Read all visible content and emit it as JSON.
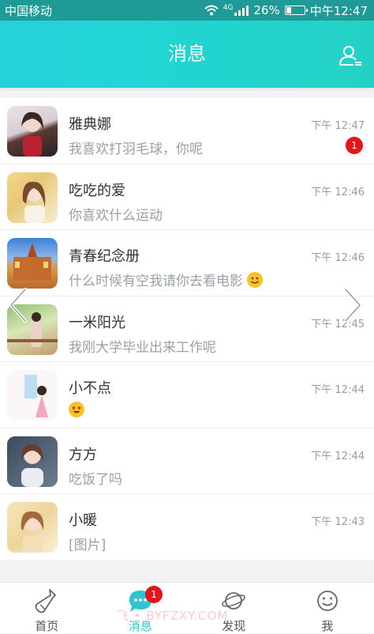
{
  "status_bar": {
    "carrier": "中国移动",
    "network": "4G",
    "battery": "26%",
    "time": "中午12:47"
  },
  "header": {
    "title": "消息",
    "contacts_icon": "contacts-icon"
  },
  "conversations": [
    {
      "name": "雅典娜",
      "preview": "我喜欢打羽毛球，你呢",
      "time": "下午 12:47",
      "unread": "1"
    },
    {
      "name": "吃吃的爱",
      "preview": "你喜欢什么运动",
      "time": "下午 12:46"
    },
    {
      "name": "青春纪念册",
      "preview": "什么时候有空我请你去看电影",
      "time": "下午 12:46",
      "emoji": "smile"
    },
    {
      "name": "一米阳光",
      "preview": "我刚大学毕业出来工作呢",
      "time": "下午 12:45"
    },
    {
      "name": "小不点",
      "preview": "",
      "time": "下午 12:44",
      "emoji": "heart-eyes"
    },
    {
      "name": "方方",
      "preview": "吃饭了吗",
      "time": "下午 12:44"
    },
    {
      "name": "小暖",
      "preview": "[图片]",
      "time": "下午 12:43"
    }
  ],
  "tabs": [
    {
      "label": "首页",
      "icon": "bottle-icon"
    },
    {
      "label": "消息",
      "icon": "chat-bubble-icon",
      "badge": "1",
      "active": true
    },
    {
      "label": "发现",
      "icon": "planet-icon"
    },
    {
      "label": "我",
      "icon": "smiley-icon"
    }
  ],
  "watermark": "飞 • BYFZXY.COM",
  "colors": {
    "header_start": "#23d3d9",
    "header_end": "#24d1c4",
    "status_bar": "#1f9a96",
    "badge": "#e4141b",
    "active_tab": "#2cc5d0"
  }
}
